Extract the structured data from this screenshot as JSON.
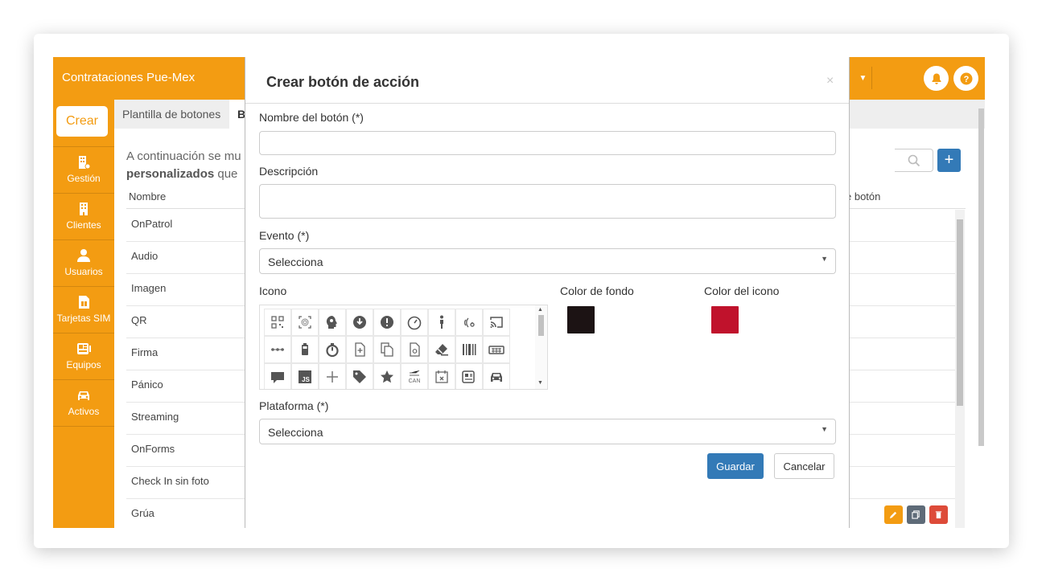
{
  "app": {
    "title": "Contrataciones Pue-Mex",
    "accent": "#f39c12"
  },
  "sidebar": {
    "create_label": "Crear",
    "items": [
      {
        "label": "Gestión",
        "icon": "building-gear-icon"
      },
      {
        "label": "Clientes",
        "icon": "building-icon"
      },
      {
        "label": "Usuarios",
        "icon": "user-icon"
      },
      {
        "label": "Tarjetas SIM",
        "icon": "sim-card-icon"
      },
      {
        "label": "Equipos",
        "icon": "device-icon"
      },
      {
        "label": "Activos",
        "icon": "car-icon"
      }
    ]
  },
  "tabs": [
    {
      "label": "Plantilla de botones"
    },
    {
      "label": "B"
    }
  ],
  "main": {
    "intro_line1": "A continuación se mu",
    "intro_bold": "personalizados",
    "intro_rest": " que",
    "col_name": "Nombre",
    "col_button": "e botón",
    "rows": [
      "OnPatrol",
      "Audio",
      "Imagen",
      "QR",
      "Firma",
      "Pánico",
      "Streaming",
      "OnForms",
      "Check In sin foto",
      "Grúa"
    ]
  },
  "modal": {
    "title": "Crear botón de acción",
    "close_glyph": "×",
    "name_label": "Nombre del botón (*)",
    "name_value": "",
    "description_label": "Descripción",
    "description_value": "",
    "event_label": "Evento (*)",
    "event_value": "Selecciona",
    "icon_label": "Icono",
    "bg_color_label": "Color de fondo",
    "bg_color": "#1c1314",
    "icon_color_label": "Color del icono",
    "icon_color": "#c0122c",
    "platform_label": "Plataforma (*)",
    "platform_value": "Selecciona",
    "save_label": "Guardar",
    "cancel_label": "Cancelar",
    "icon_options": [
      "qr-code-icon",
      "fingerprint-icon",
      "head-idea-icon",
      "download-circle-icon",
      "alert-circle-icon",
      "speedometer-icon",
      "person-walking-icon",
      "nfc-signal-icon",
      "cast-icon",
      "dots-connector-icon",
      "battery-icon",
      "stopwatch-icon",
      "file-plus-icon",
      "copy-icon",
      "file-lock-icon",
      "eraser-icon",
      "barcode-icon",
      "keyboard-icon",
      "comment-icon",
      "js-file-icon",
      "plus-icon",
      "tag-icon",
      "star-icon",
      "can-bus-icon",
      "calendar-x-icon",
      "newspaper-icon",
      "car-front-icon"
    ]
  }
}
